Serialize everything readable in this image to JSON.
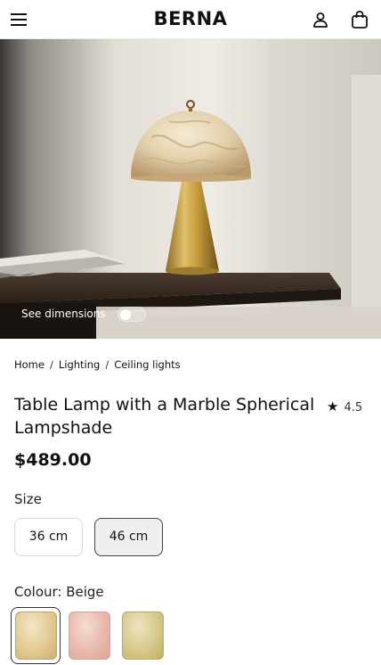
{
  "header": {
    "logo": "BERNA",
    "menu_icon": "hamburger-menu-icon",
    "account_icon": "user-icon",
    "bag_icon": "shopping-bag-icon"
  },
  "hero": {
    "dimensions_label": "See dimensions",
    "dimensions_toggle_on": false
  },
  "breadcrumb": {
    "items": [
      "Home",
      "Lighting",
      "Ceiling lights"
    ],
    "separator": "/"
  },
  "product": {
    "title": "Table Lamp with a Marble Spherical Lampshade",
    "rating": "4.5",
    "rating_icon": "star-icon",
    "price": "$489.00"
  },
  "size": {
    "label": "Size",
    "options": [
      "36 cm",
      "46 cm"
    ],
    "selected": "46 cm"
  },
  "colour": {
    "label": "Colour: Beige",
    "swatches": [
      {
        "name": "Beige",
        "color": "#e7cf9a",
        "selected": true
      },
      {
        "name": "Pink",
        "color": "#ebbbb0",
        "selected": false
      },
      {
        "name": "Green",
        "color": "#d9cc90",
        "selected": false
      }
    ]
  },
  "colors": {
    "brass": "#c9a445",
    "marble": "#e9dcc0",
    "table": "#3a2c22"
  }
}
